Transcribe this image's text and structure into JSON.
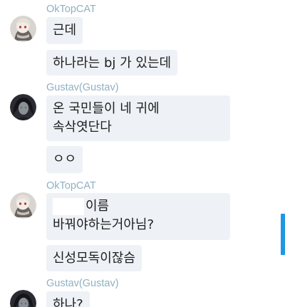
{
  "messages": [
    {
      "sender": "OkTopCAT",
      "avatar": "cat-avatar",
      "bubbles": [
        {
          "lines": [
            "근데"
          ]
        },
        {
          "lines": [
            "하나라는 bj 가 있는데"
          ]
        }
      ]
    },
    {
      "sender": "Gustav(Gustav)",
      "avatar": "dark-avatar",
      "bubbles": [
        {
          "lines": [
            "온 국민들이 네 귀에",
            "속삭엿단다"
          ]
        },
        {
          "lines": [
            "ㅇㅇ"
          ]
        }
      ]
    },
    {
      "sender": "OkTopCAT",
      "avatar": "cat-avatar",
      "bubbles": [
        {
          "lines": [
            "이름",
            "바꿔야하는거아님?"
          ]
        },
        {
          "lines": [
            "신성모독이잖슴"
          ]
        }
      ]
    },
    {
      "sender": "Gustav(Gustav)",
      "avatar": "dark-avatar",
      "bubbles": [
        {
          "lines": [
            "하나?"
          ]
        }
      ]
    }
  ],
  "colors": {
    "sender_name": "#8fb0c2",
    "bubble_bg": "#eef1f6",
    "scrollbar": "#1e98e6"
  }
}
